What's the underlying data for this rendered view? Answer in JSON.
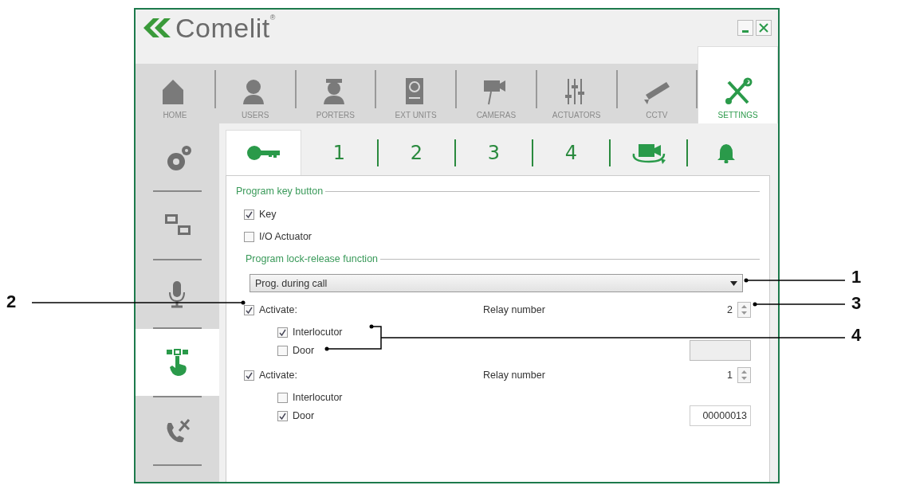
{
  "window": {
    "logo": "Comelit$^{®}$",
    "controls": [
      {
        "kind": "minimize"
      },
      {
        "kind": "close"
      }
    ]
  },
  "main_tabs": [
    {
      "label": "HOME",
      "selected": false
    },
    {
      "label": "USERS",
      "selected": false
    },
    {
      "label": "PORTERS",
      "selected": false
    },
    {
      "label": "EXT UNITS",
      "selected": false
    },
    {
      "label": "CAMERAS",
      "selected": false
    },
    {
      "label": "ACTUATORS",
      "selected": false
    },
    {
      "label": "CCTV",
      "selected": false
    },
    {
      "label": "SETTINGS",
      "selected": true
    }
  ],
  "sidebar": {
    "items": [
      {
        "selected": false
      },
      {
        "selected": false
      },
      {
        "selected": false
      },
      {
        "selected": true
      },
      {
        "selected": false
      }
    ]
  },
  "sub_tabs": [
    {
      "kind": "icon",
      "selected": true
    },
    {
      "kind": "text",
      "label": "1",
      "selected": false
    },
    {
      "kind": "text",
      "label": "2",
      "selected": false
    },
    {
      "kind": "text",
      "label": "3",
      "selected": false
    },
    {
      "kind": "text",
      "label": "4",
      "selected": false
    },
    {
      "kind": "icon",
      "selected": false
    },
    {
      "kind": "icon",
      "selected": false
    }
  ],
  "key_section": {
    "title": "Program key button",
    "options": [
      {
        "label": "Key",
        "checked": true
      },
      {
        "label": "I/O Actuator",
        "checked": false
      }
    ]
  },
  "lock_section": {
    "title": "Program lock-release function",
    "mode": {
      "value": "Prog. during call"
    },
    "relays": [
      {
        "activate": {
          "label": "Activate:",
          "checked": true
        },
        "relay_label": "Relay number",
        "relay_value": "2",
        "options": [
          {
            "label": "Interlocutor",
            "checked": true
          },
          {
            "label": "Door",
            "checked": false
          }
        ],
        "code": {
          "disabled": true
        }
      },
      {
        "activate": {
          "label": "Activate:",
          "checked": true
        },
        "relay_label": "Relay number",
        "relay_value": "1",
        "options": [
          {
            "label": "Interlocutor",
            "checked": false
          },
          {
            "label": "Door",
            "checked": true
          }
        ],
        "code": {
          "value": "00000013",
          "disabled": false
        }
      }
    ]
  },
  "callouts": [
    {
      "number": "1"
    },
    {
      "number": "2"
    },
    {
      "number": "3"
    },
    {
      "number": "4"
    }
  ]
}
